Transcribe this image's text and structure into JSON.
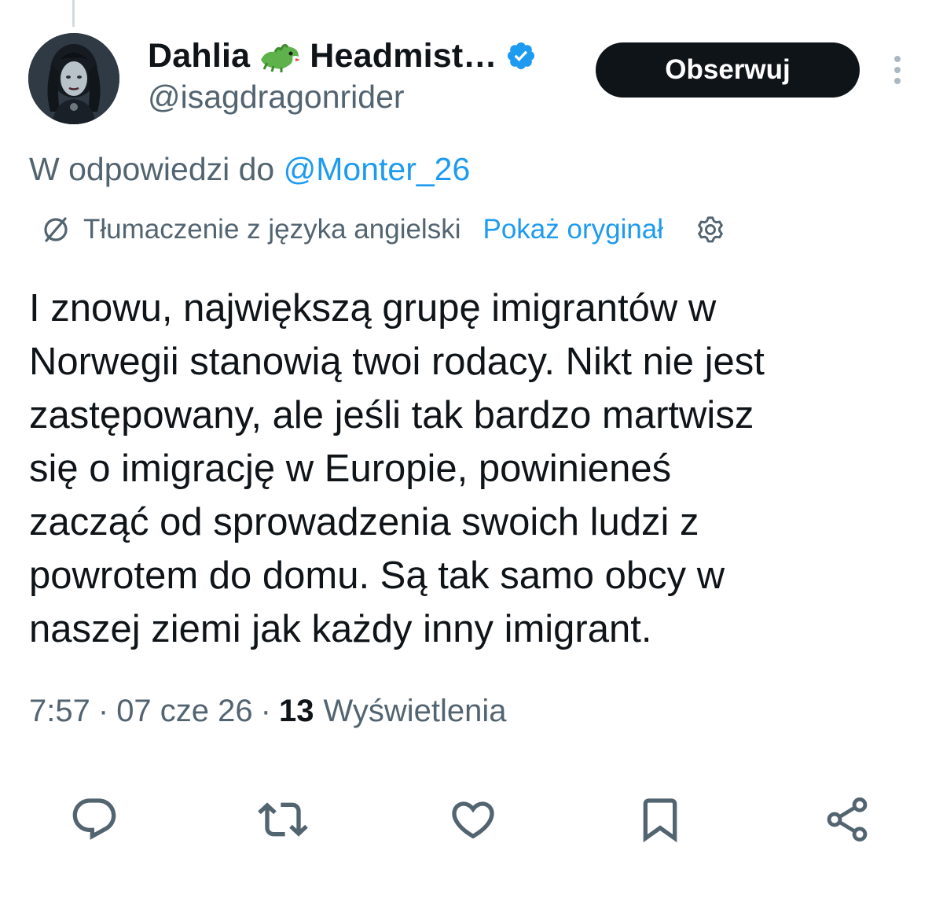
{
  "tweet": {
    "author": {
      "display_name": "Dahlia",
      "display_name_suffix": "Headmist…",
      "emoji": "dragon-emoji",
      "verified": true,
      "handle": "@isagdragonrider",
      "avatar": "gothic-woman-avatar"
    },
    "follow_label": "Obserwuj",
    "reply_to": {
      "prefix": "W odpowiedzi do",
      "mention": "@Monter_26"
    },
    "translation": {
      "label": "Tłumaczenie z języka angielski",
      "show_original": "Pokaż oryginał"
    },
    "text": "I znowu, największą grupę imigrantów w\nNorwegii stanowią twoi rodacy. Nikt nie jest\nzastępowany, ale jeśli tak bardzo martwisz\nsię o imigrację w Europie, powinieneś\nzacząć od sprowadzenia swoich ludzi z\npowrotem do domu. Są tak samo obcy w\nnaszej ziemi jak każdy inny imigrant.",
    "meta": {
      "time": "7:57",
      "separator": "·",
      "date": "07 cze 26",
      "views_count": "13",
      "views_label": "Wyświetlenia"
    }
  },
  "colors": {
    "text": "#0f1419",
    "secondary": "#536471",
    "link": "#1d9bf0",
    "verified": "#1d9bf0",
    "follow_bg": "#0f1419"
  },
  "icons": {
    "reply": "reply-icon",
    "retweet": "retweet-icon",
    "like": "heart-icon",
    "bookmark": "bookmark-icon",
    "share": "share-icon",
    "more": "more-vertical-icon",
    "settings": "gear-icon",
    "translate": "translate-icon"
  }
}
